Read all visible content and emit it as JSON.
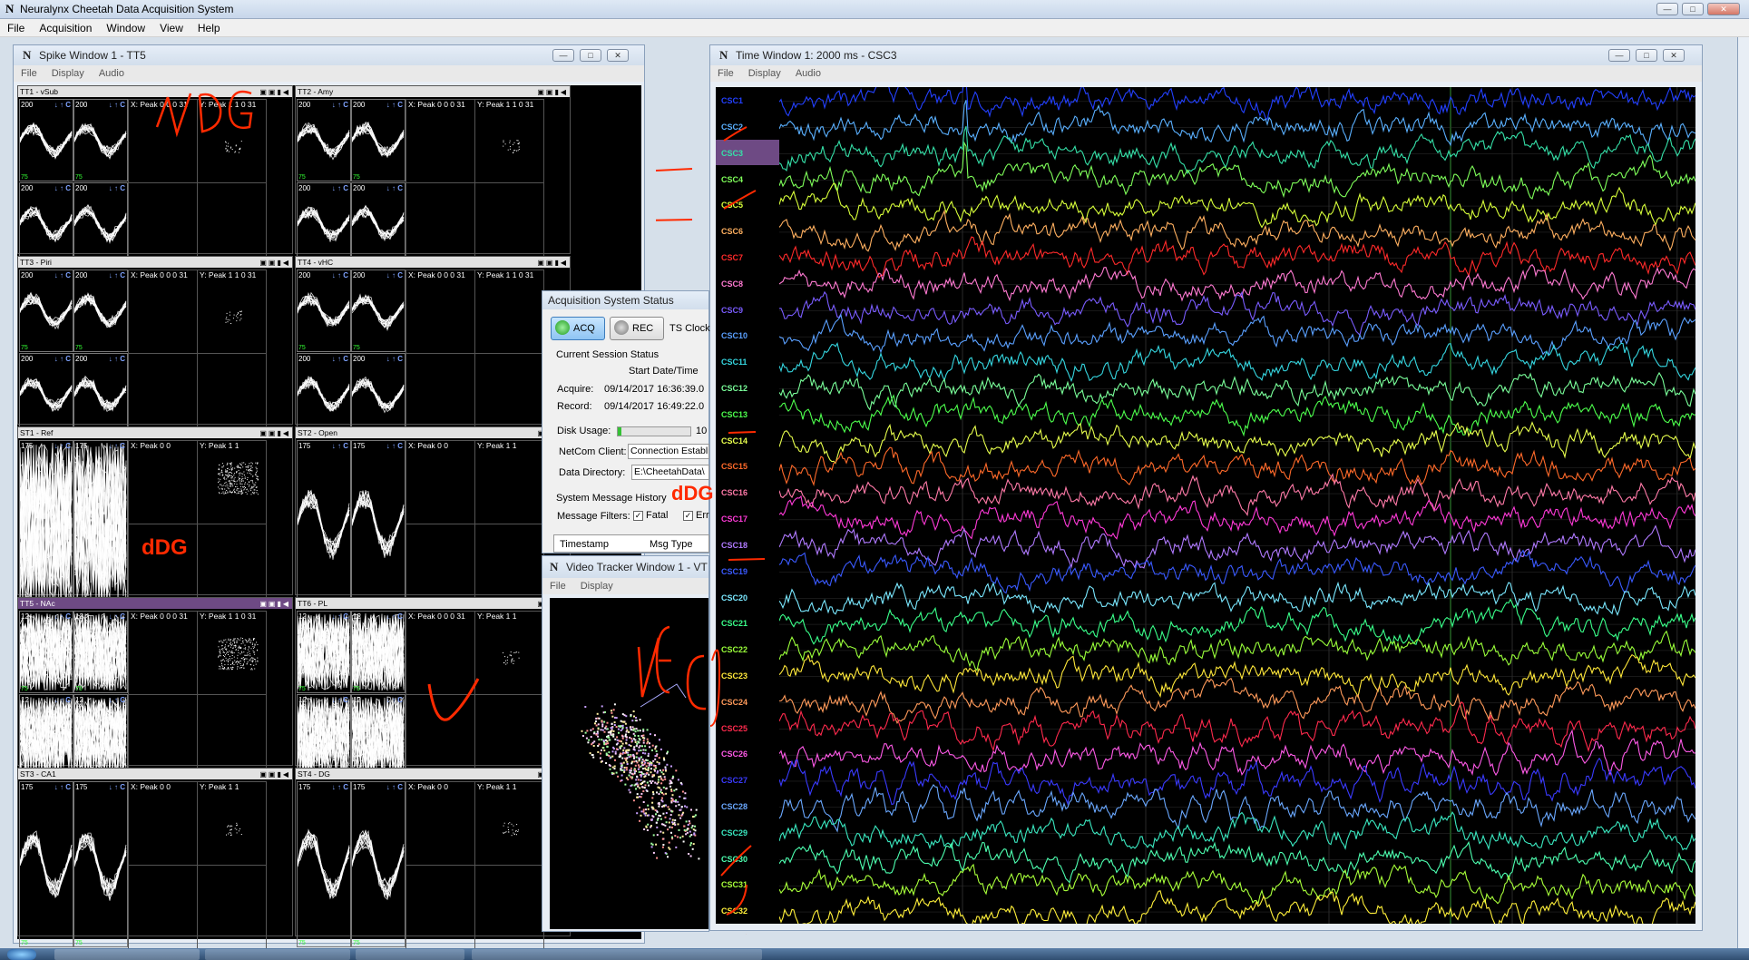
{
  "app": {
    "logo": "N",
    "title": "Neuralynx Cheetah Data Acquisition System",
    "menu": [
      "File",
      "Acquisition",
      "Window",
      "View",
      "Help"
    ]
  },
  "spike_window": {
    "title": "Spike Window 1 - TT5",
    "menu": [
      "File",
      "Display",
      "Audio"
    ],
    "panels": [
      {
        "name": "TT1 - vSub",
        "gains": [
          "200",
          "200",
          "200",
          "200"
        ],
        "peak_x": "X: Peak 0 0 0 31",
        "peak_y": "Y: Peak 1 1 0 31",
        "selected": false
      },
      {
        "name": "TT2 - Amy",
        "gains": [
          "200",
          "200",
          "200",
          "200"
        ],
        "peak_x": "X: Peak 0 0 0 31",
        "peak_y": "Y: Peak 1 1 0 31",
        "selected": false
      },
      {
        "name": "TT3 - Piri",
        "gains": [
          "200",
          "200",
          "200",
          "200"
        ],
        "peak_x": "X: Peak 0 0 0 31",
        "peak_y": "Y: Peak 1 1 0 31",
        "selected": false
      },
      {
        "name": "TT4 - vHC",
        "gains": [
          "200",
          "200",
          "200",
          "200"
        ],
        "peak_x": "X: Peak 0 0 0 31",
        "peak_y": "Y: Peak 1 1 0 31",
        "selected": false
      },
      {
        "name": "ST1 - Ref",
        "gains": [
          "175",
          "175"
        ],
        "peak_x": "X: Peak 0 0",
        "peak_y": "Y: Peak 1 1",
        "selected": false
      },
      {
        "name": "ST2 - Open",
        "gains": [
          "175",
          "175"
        ],
        "peak_x": "X: Peak 0 0",
        "peak_y": "Y: Peak 1 1",
        "selected": false
      },
      {
        "name": "TT5 - NAc",
        "gains": [
          "12",
          "12",
          "12",
          "12"
        ],
        "peak_x": "X: Peak 0 0 0 31",
        "peak_y": "Y: Peak 1 1 0 31",
        "selected": true
      },
      {
        "name": "TT6 - PL",
        "gains": [
          "12",
          "12",
          "12",
          "12"
        ],
        "peak_x": "X: Peak 0 0 0 31",
        "peak_y": "Y: Peak 1 1",
        "selected": false
      },
      {
        "name": "ST3 - CA1",
        "gains": [
          "175",
          "175"
        ],
        "peak_x": "X: Peak 0 0",
        "peak_y": "Y: Peak 1 1",
        "selected": false
      },
      {
        "name": "ST4 - DG",
        "gains": [
          "175",
          "175"
        ],
        "peak_x": "X: Peak 0 0",
        "peak_y": "Y: Peak 1 1",
        "selected": false
      }
    ],
    "footer_value": "75"
  },
  "status_window": {
    "title": "Acquisition System Status",
    "acq_label": "ACQ",
    "rec_label": "REC",
    "ts_clock_label": "TS Clock",
    "session_heading": "Current Session Status",
    "start_heading": "Start Date/Time",
    "acquire_label": "Acquire:",
    "acquire_value": "09/14/2017 16:36:39.0",
    "record_label": "Record:",
    "record_value": "09/14/2017 16:49:22.0",
    "disk_label": "Disk Usage:",
    "disk_value": "10",
    "disk_fraction": 0.05,
    "netcom_label": "NetCom Client:",
    "netcom_value": "Connection Establi",
    "datadir_label": "Data Directory:",
    "datadir_value": "E:\\CheetahData\\",
    "history_heading": "System Message History",
    "filters_label": "Message Filters:",
    "filter_fatal": "Fatal",
    "filter_err": "Err",
    "col_timestamp": "Timestamp",
    "col_msgtype": "Msg Type"
  },
  "video_window": {
    "title": "Video Tracker Window 1 - VT",
    "menu": [
      "File",
      "Display"
    ]
  },
  "time_window": {
    "title": "Time Window 1: 2000 ms - CSC3",
    "menu": [
      "File",
      "Display",
      "Audio"
    ],
    "selected_channel": "CSC3",
    "channels": [
      {
        "name": "CSC1",
        "color": "#2340ff"
      },
      {
        "name": "CSC2",
        "color": "#5ab0ff"
      },
      {
        "name": "CSC3",
        "color": "#35e0a8"
      },
      {
        "name": "CSC4",
        "color": "#7fff5a"
      },
      {
        "name": "CSC5",
        "color": "#d8ff3a"
      },
      {
        "name": "CSC6",
        "color": "#ffb060"
      },
      {
        "name": "CSC7",
        "color": "#ff2a2a"
      },
      {
        "name": "CSC8",
        "color": "#ff7ad2"
      },
      {
        "name": "CSC9",
        "color": "#7a5cff"
      },
      {
        "name": "CSC10",
        "color": "#5aa0ff"
      },
      {
        "name": "CSC11",
        "color": "#35d6e0"
      },
      {
        "name": "CSC12",
        "color": "#7aff9a"
      },
      {
        "name": "CSC13",
        "color": "#4dff4d"
      },
      {
        "name": "CSC14",
        "color": "#e8ff4d"
      },
      {
        "name": "CSC15",
        "color": "#ff6a2a"
      },
      {
        "name": "CSC16",
        "color": "#ff7aa8"
      },
      {
        "name": "CSC17",
        "color": "#ff3ad8"
      },
      {
        "name": "CSC18",
        "color": "#b07aff"
      },
      {
        "name": "CSC19",
        "color": "#3a5aff"
      },
      {
        "name": "CSC20",
        "color": "#7ae8ff"
      },
      {
        "name": "CSC21",
        "color": "#3aff8a"
      },
      {
        "name": "CSC22",
        "color": "#9aff3a"
      },
      {
        "name": "CSC23",
        "color": "#ffe83a"
      },
      {
        "name": "CSC24",
        "color": "#ff9a5a"
      },
      {
        "name": "CSC25",
        "color": "#ff2a4d"
      },
      {
        "name": "CSC26",
        "color": "#ff5ae8"
      },
      {
        "name": "CSC27",
        "color": "#3a3aff"
      },
      {
        "name": "CSC28",
        "color": "#6aa8ff"
      },
      {
        "name": "CSC29",
        "color": "#3ae8c0"
      },
      {
        "name": "CSC30",
        "color": "#4dffb0"
      },
      {
        "name": "CSC31",
        "color": "#a8ff3a"
      },
      {
        "name": "CSC32",
        "color": "#fff03a"
      }
    ]
  },
  "annotations": {
    "ddg_spike": "dDG",
    "ddg_status": "dDG"
  }
}
